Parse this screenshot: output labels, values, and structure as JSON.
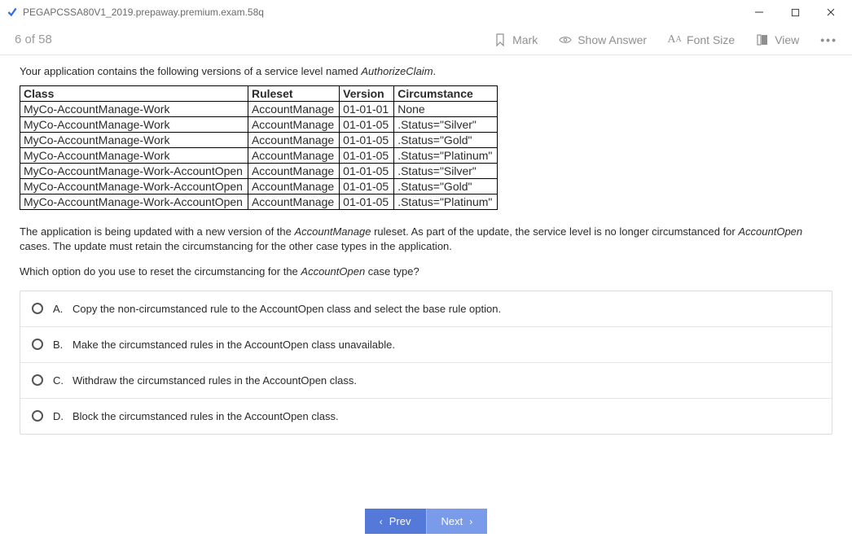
{
  "window": {
    "title": "PEGAPCSSA80V1_2019.prepaway.premium.exam.58q"
  },
  "toolbar": {
    "counter": "6 of 58",
    "mark": "Mark",
    "show_answer": "Show Answer",
    "font_size": "Font Size",
    "view": "View"
  },
  "question": {
    "intro_pre": "Your application contains the following versions of a service level named ",
    "intro_italic": "AuthorizeClaim",
    "intro_post": ".",
    "table": {
      "headers": {
        "class": "Class",
        "ruleset": "Ruleset",
        "version": "Version",
        "circumstance": "Circumstance"
      },
      "rows": [
        {
          "class": "MyCo-AccountManage-Work",
          "ruleset": "AccountManage",
          "version": "01-01-01",
          "circumstance": "None"
        },
        {
          "class": "MyCo-AccountManage-Work",
          "ruleset": "AccountManage",
          "version": "01-01-05",
          "circumstance": ".Status=\"Silver\""
        },
        {
          "class": "MyCo-AccountManage-Work",
          "ruleset": "AccountManage",
          "version": "01-01-05",
          "circumstance": ".Status=\"Gold\""
        },
        {
          "class": "MyCo-AccountManage-Work",
          "ruleset": "AccountManage",
          "version": "01-01-05",
          "circumstance": ".Status=\"Platinum\""
        },
        {
          "class": "MyCo-AccountManage-Work-AccountOpen",
          "ruleset": "AccountManage",
          "version": "01-01-05",
          "circumstance": ".Status=\"Silver\""
        },
        {
          "class": "MyCo-AccountManage-Work-AccountOpen",
          "ruleset": "AccountManage",
          "version": "01-01-05",
          "circumstance": ".Status=\"Gold\""
        },
        {
          "class": "MyCo-AccountManage-Work-AccountOpen",
          "ruleset": "AccountManage",
          "version": "01-01-05",
          "circumstance": ".Status=\"Platinum\""
        }
      ]
    },
    "para_pre": "The application is being updated with a new version of the ",
    "para_it1": "AccountManage",
    "para_mid": " ruleset. As part of the update, the service level is no longer circumstanced for ",
    "para_it2": "AccountOpen",
    "para_post": " cases. The update must retain the circumstancing for the other case types in the application.",
    "ask_pre": "Which option do you use to reset the circumstancing for the ",
    "ask_it": "AccountOpen",
    "ask_post": " case type?",
    "options": [
      {
        "letter": "A.",
        "text": "Copy the non-circumstanced rule to the AccountOpen class and select the base rule option."
      },
      {
        "letter": "B.",
        "text": "Make the circumstanced rules in the AccountOpen class unavailable."
      },
      {
        "letter": "C.",
        "text": "Withdraw the circumstanced rules in the AccountOpen class."
      },
      {
        "letter": "D.",
        "text": "Block the circumstanced rules in the AccountOpen class."
      }
    ]
  },
  "nav": {
    "prev": "Prev",
    "next": "Next"
  }
}
